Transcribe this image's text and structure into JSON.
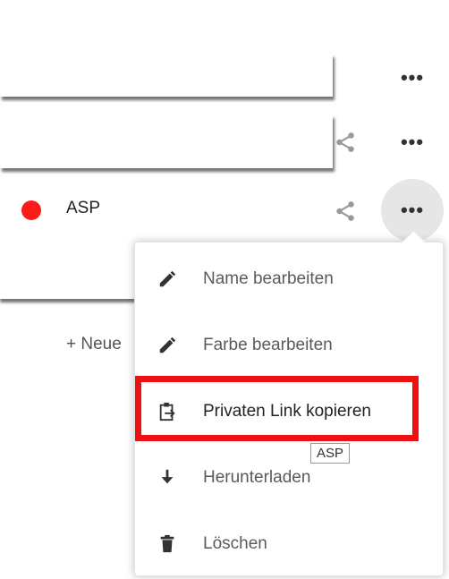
{
  "calendars": [
    {
      "name": "",
      "has_share": false,
      "actions_icon": "more-horizontal-icon",
      "actions_label": "•••"
    },
    {
      "name": "",
      "has_share": true,
      "actions_icon": "more-horizontal-icon",
      "actions_label": "•••"
    },
    {
      "name": "ASP",
      "color": "#ff1a1a",
      "has_share": true,
      "actions_label": "•••",
      "actions_active": true
    },
    {
      "name": ""
    }
  ],
  "new_calendar_label": "+ Neue",
  "context_menu": {
    "items": [
      {
        "label": "Name bearbeiten",
        "icon": "pencil-icon"
      },
      {
        "label": "Farbe bearbeiten",
        "icon": "pencil-icon"
      },
      {
        "label": "Privaten Link kopieren",
        "icon": "clipboard-icon",
        "highlighted": true
      },
      {
        "label": "Herunterladen",
        "icon": "download-icon"
      },
      {
        "label": "Löschen",
        "icon": "trash-icon"
      }
    ]
  },
  "tooltip": "ASP",
  "highlight_color": "#ee1111"
}
